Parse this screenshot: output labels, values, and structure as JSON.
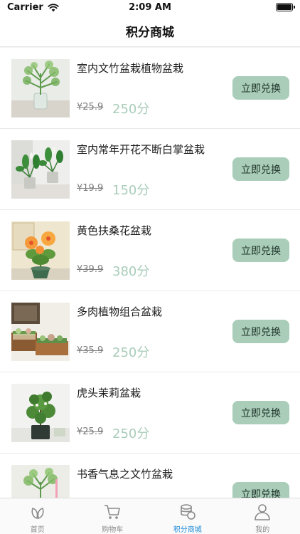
{
  "status_bar": {
    "carrier": "Carrier",
    "time": "2:09 AM"
  },
  "header": {
    "title": "积分商城"
  },
  "products": [
    {
      "name": "室内文竹盆栽植物盆栽",
      "original_price": "¥25.9",
      "points": "250分",
      "button": "立即兑换",
      "image_icon": "asparagus-fern-plant"
    },
    {
      "name": "室内常年开花不断白掌盆栽",
      "original_price": "¥19.9",
      "points": "150分",
      "button": "立即兑换",
      "image_icon": "peace-lily-plant"
    },
    {
      "name": "黄色扶桑花盆栽",
      "original_price": "¥39.9",
      "points": "380分",
      "button": "立即兑换",
      "image_icon": "hibiscus-plant"
    },
    {
      "name": "多肉植物组合盆栽",
      "original_price": "¥35.9",
      "points": "250分",
      "button": "立即兑换",
      "image_icon": "succulent-combo-plant"
    },
    {
      "name": "虎头茉莉盆栽",
      "original_price": "¥25.9",
      "points": "250分",
      "button": "立即兑换",
      "image_icon": "jasmine-plant"
    },
    {
      "name": "书香气息之文竹盆栽",
      "original_price": "",
      "points": "",
      "button": "立即兑换",
      "image_icon": "asparagus-fern-plant"
    }
  ],
  "tabbar": {
    "tabs": [
      {
        "label": "首页",
        "icon": "leaf-icon"
      },
      {
        "label": "购物车",
        "icon": "cart-icon"
      },
      {
        "label": "积分商城",
        "icon": "coins-icon",
        "active": true
      },
      {
        "label": "我的",
        "icon": "person-icon"
      }
    ]
  },
  "colors": {
    "accent": "#a9cdb9",
    "active_tab": "#1f8bd8"
  }
}
